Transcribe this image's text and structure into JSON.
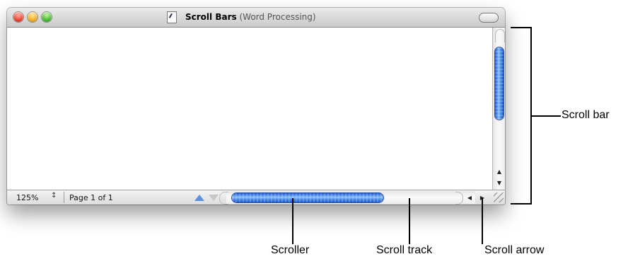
{
  "window": {
    "title": "Scroll Bars",
    "subtitle": "(Word Processing)"
  },
  "status_bar": {
    "zoom": "125%",
    "stepper_glyph": "↕",
    "page_info": "Page 1 of 1"
  },
  "vertical_scrollbar": {
    "up_arrow": "▲",
    "down_arrow": "▼"
  },
  "horizontal_scrollbar": {
    "left_arrow": "◀",
    "right_arrow": "▶"
  },
  "callouts": {
    "scroll_bar": "Scroll bar",
    "scroller": "Scroller",
    "scroll_track": "Scroll track",
    "scroll_arrow": "Scroll arrow"
  },
  "colors": {
    "scroller_blue": "#3f7fe0",
    "window_chrome": "#d0d0d0"
  },
  "icons": [
    "close-button",
    "minimize-button",
    "zoom-button",
    "document-icon",
    "toolbar-toggle",
    "resize-grip"
  ]
}
